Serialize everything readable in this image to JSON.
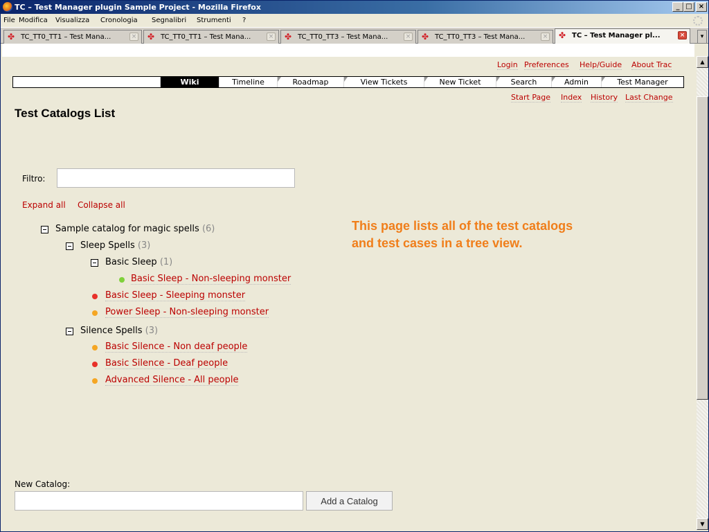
{
  "window": {
    "title": "TC – Test Manager plugin Sample Project - Mozilla Firefox"
  },
  "menubar": [
    "File",
    "Modifica",
    "Visualizza",
    "Cronologia",
    "Segnalibri",
    "Strumenti",
    "?"
  ],
  "tabs": [
    {
      "label": "TC_TT0_TT1 – Test Mana...",
      "active": false
    },
    {
      "label": "TC_TT0_TT1 – Test Mana...",
      "active": false
    },
    {
      "label": "TC_TT0_TT3 – Test Mana...",
      "active": false
    },
    {
      "label": "TC_TT0_TT3 – Test Mana...",
      "active": false
    },
    {
      "label": "TC – Test Manager pl...",
      "active": true
    }
  ],
  "metanav": [
    "Login",
    "Preferences",
    "Help/Guide",
    "About Trac"
  ],
  "mainnav": [
    "Wiki",
    "Timeline",
    "Roadmap",
    "View Tickets",
    "New Ticket",
    "Search",
    "Admin",
    "Test Manager"
  ],
  "ctxtnav": [
    "Start Page",
    "Index",
    "History",
    "Last Change"
  ],
  "page": {
    "title": "Test Catalogs List",
    "filter_label": "Filtro:",
    "filter_value": "",
    "expand_all": "Expand all",
    "collapse_all": "Collapse all",
    "callout_line1": "This page lists all of the test catalogs",
    "callout_line2": "and test cases in a tree view.",
    "new_catalog_label": "New Catalog:",
    "new_catalog_value": "",
    "add_button": "Add a Catalog"
  },
  "tree": {
    "catalog": {
      "name": "Sample catalog for magic spells",
      "count": "(6)"
    },
    "sleep": {
      "name": "Sleep Spells",
      "count": "(3)"
    },
    "basic_sleep": {
      "name": "Basic Sleep",
      "count": "(1)"
    },
    "silence": {
      "name": "Silence Spells",
      "count": "(3)"
    },
    "cases": [
      {
        "label": "Basic Sleep - Non-sleeping monster",
        "status": "passed"
      },
      {
        "label": "Basic Sleep - Sleeping monster",
        "status": "failed"
      },
      {
        "label": "Power Sleep - Non-sleeping monster",
        "status": "to-be-tested"
      },
      {
        "label": "Basic Silence - Non deaf people",
        "status": "to-be-tested"
      },
      {
        "label": "Basic Silence - Deaf people",
        "status": "failed"
      },
      {
        "label": "Advanced Silence - All people",
        "status": "to-be-tested"
      }
    ]
  },
  "colors": {
    "link": "#bb0000",
    "callout": "#f07e1a",
    "passed": "#7fd13b",
    "failed": "#e8312a",
    "to_be_tested": "#f5a623"
  }
}
